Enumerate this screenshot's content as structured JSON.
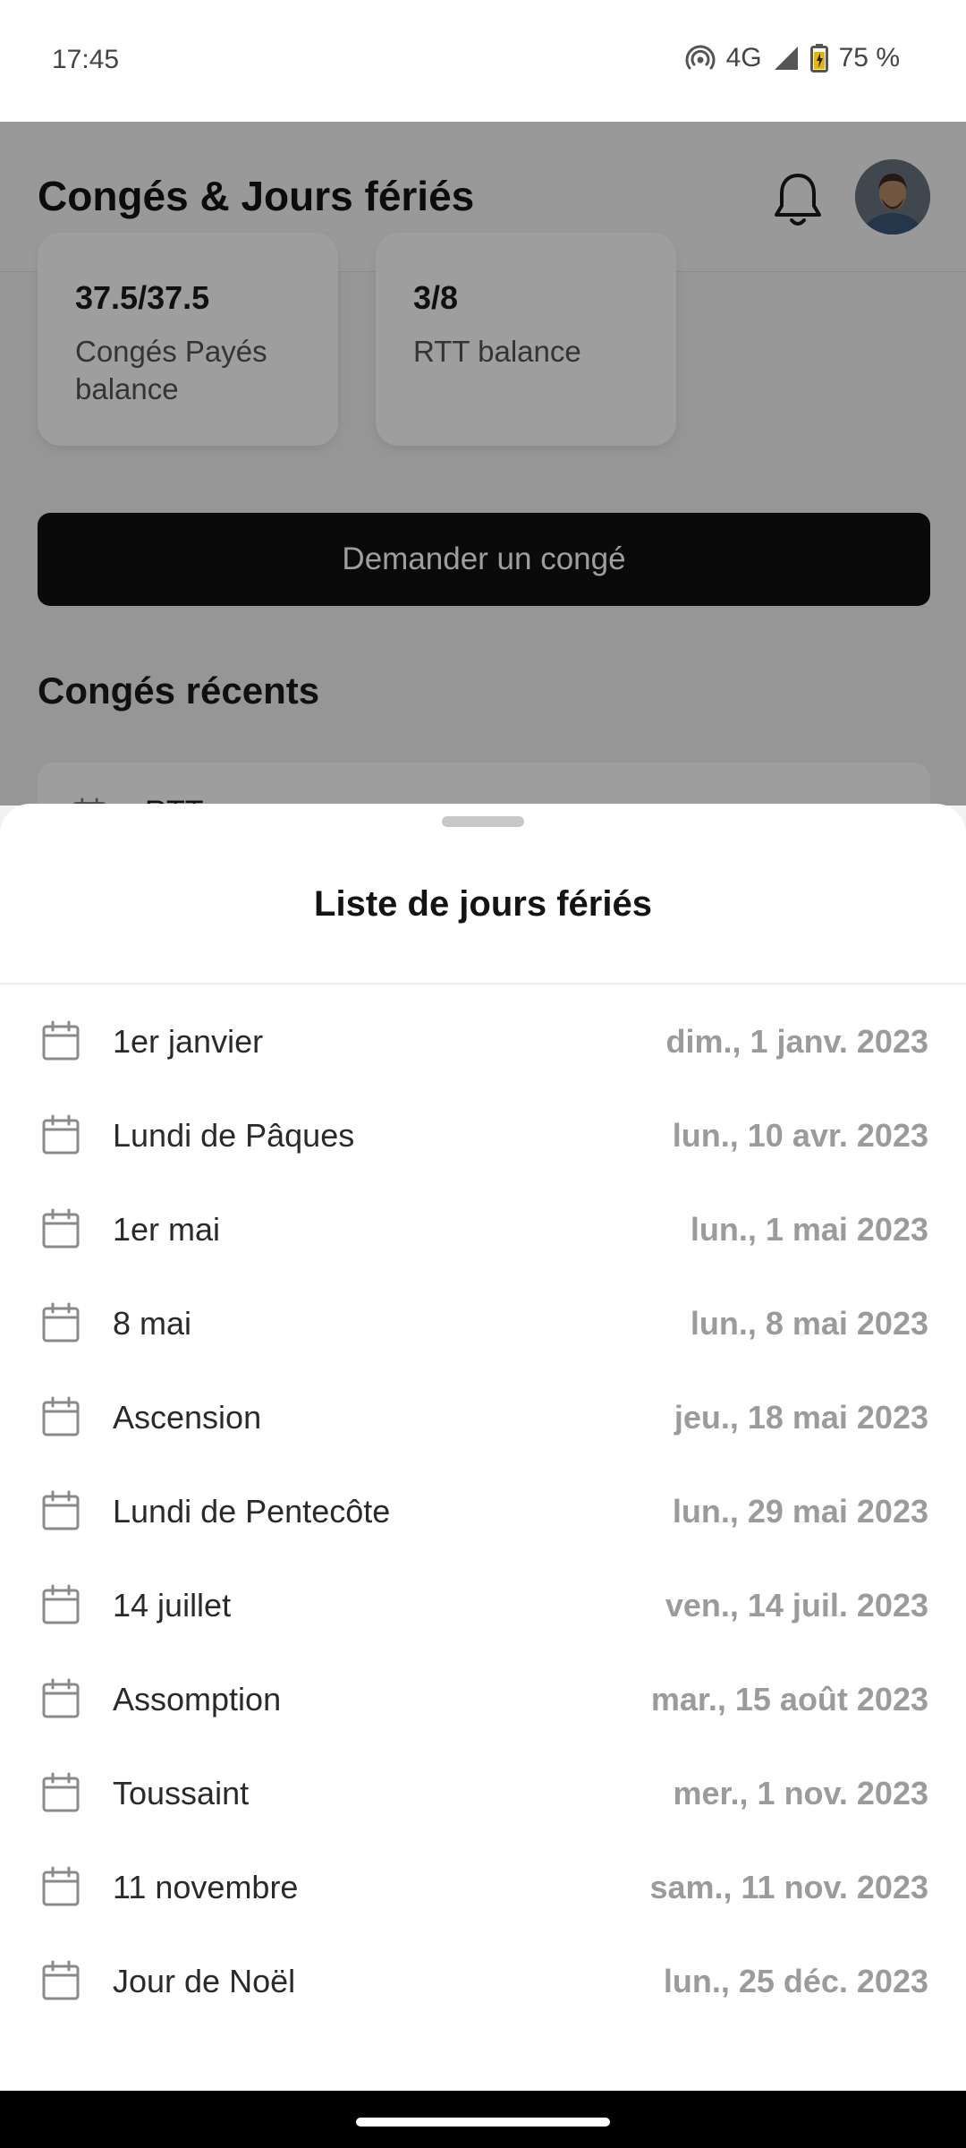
{
  "status_bar": {
    "time": "17:45",
    "network": "4G",
    "battery": "75 %",
    "icons": [
      "hotspot-icon",
      "signal-icon",
      "battery-charging-icon"
    ]
  },
  "header": {
    "title": "Congés & Jours fériés",
    "icons": [
      "bell-icon",
      "avatar"
    ]
  },
  "balances": [
    {
      "value": "37.5/37.5",
      "label": "Congés Payés balance"
    },
    {
      "value": "3/8",
      "label": "RTT balance"
    }
  ],
  "request_button": "Demander un congé",
  "recent": {
    "title": "Congés récents",
    "first_item_label": "RTT"
  },
  "sheet": {
    "title": "Liste de jours fériés",
    "holidays": [
      {
        "name": "1er janvier",
        "date": "dim., 1 janv. 2023"
      },
      {
        "name": "Lundi de Pâques",
        "date": "lun., 10 avr. 2023"
      },
      {
        "name": "1er mai",
        "date": "lun., 1 mai 2023"
      },
      {
        "name": "8 mai",
        "date": "lun., 8 mai 2023"
      },
      {
        "name": "Ascension",
        "date": "jeu., 18 mai 2023"
      },
      {
        "name": "Lundi de Pentecôte",
        "date": "lun., 29 mai 2023"
      },
      {
        "name": "14 juillet",
        "date": "ven., 14 juil. 2023"
      },
      {
        "name": "Assomption",
        "date": "mar., 15 août 2023"
      },
      {
        "name": "Toussaint",
        "date": "mer., 1 nov. 2023"
      },
      {
        "name": "11 novembre",
        "date": "sam., 11 nov. 2023"
      },
      {
        "name": "Jour de Noël",
        "date": "lun., 25 déc. 2023"
      }
    ]
  },
  "colors": {
    "primary_button": "#111111",
    "date_text": "#9b9b9b",
    "scrim": "rgba(0,0,0,0.38)"
  }
}
